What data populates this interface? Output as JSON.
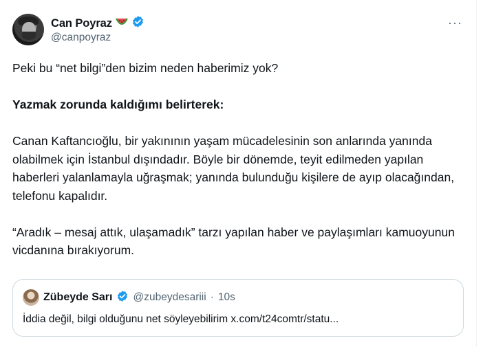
{
  "post": {
    "author": {
      "name": "Can Poyraz",
      "emoji": "🍉",
      "handle": "@canpoyraz"
    },
    "more_label": "···",
    "paragraphs": [
      "Peki bu “net bilgi”den bizim neden haberimiz yok?",
      "Yazmak zorunda kaldığımı belirterek:",
      "Canan Kaftancıoğlu, bir yakınının yaşam mücadelesinin son anlarında yanında olabilmek için İstanbul dışındadır. Böyle bir dönemde, teyit edilmeden yapılan haberleri yalanlamayla uğraşmak; yanında bulunduğu kişilere de ayıp olacağından, telefonu kapalıdır.",
      "“Aradık – mesaj attık, ulaşamadık” tarzı yapılan haber ve paylaşımları kamuoyunun vicdanına bırakıyorum."
    ]
  },
  "quote": {
    "name": "Zübeyde Sarı",
    "handle": "@zubeydesariii",
    "separator": "·",
    "time": "10s",
    "text": "İddia değil, bilgi olduğunu net söyleyebilirim x.com/t24comtr/statu..."
  },
  "colors": {
    "verified": "#1d9bf0",
    "secondary_text": "#536471",
    "border": "#cfd9de"
  }
}
